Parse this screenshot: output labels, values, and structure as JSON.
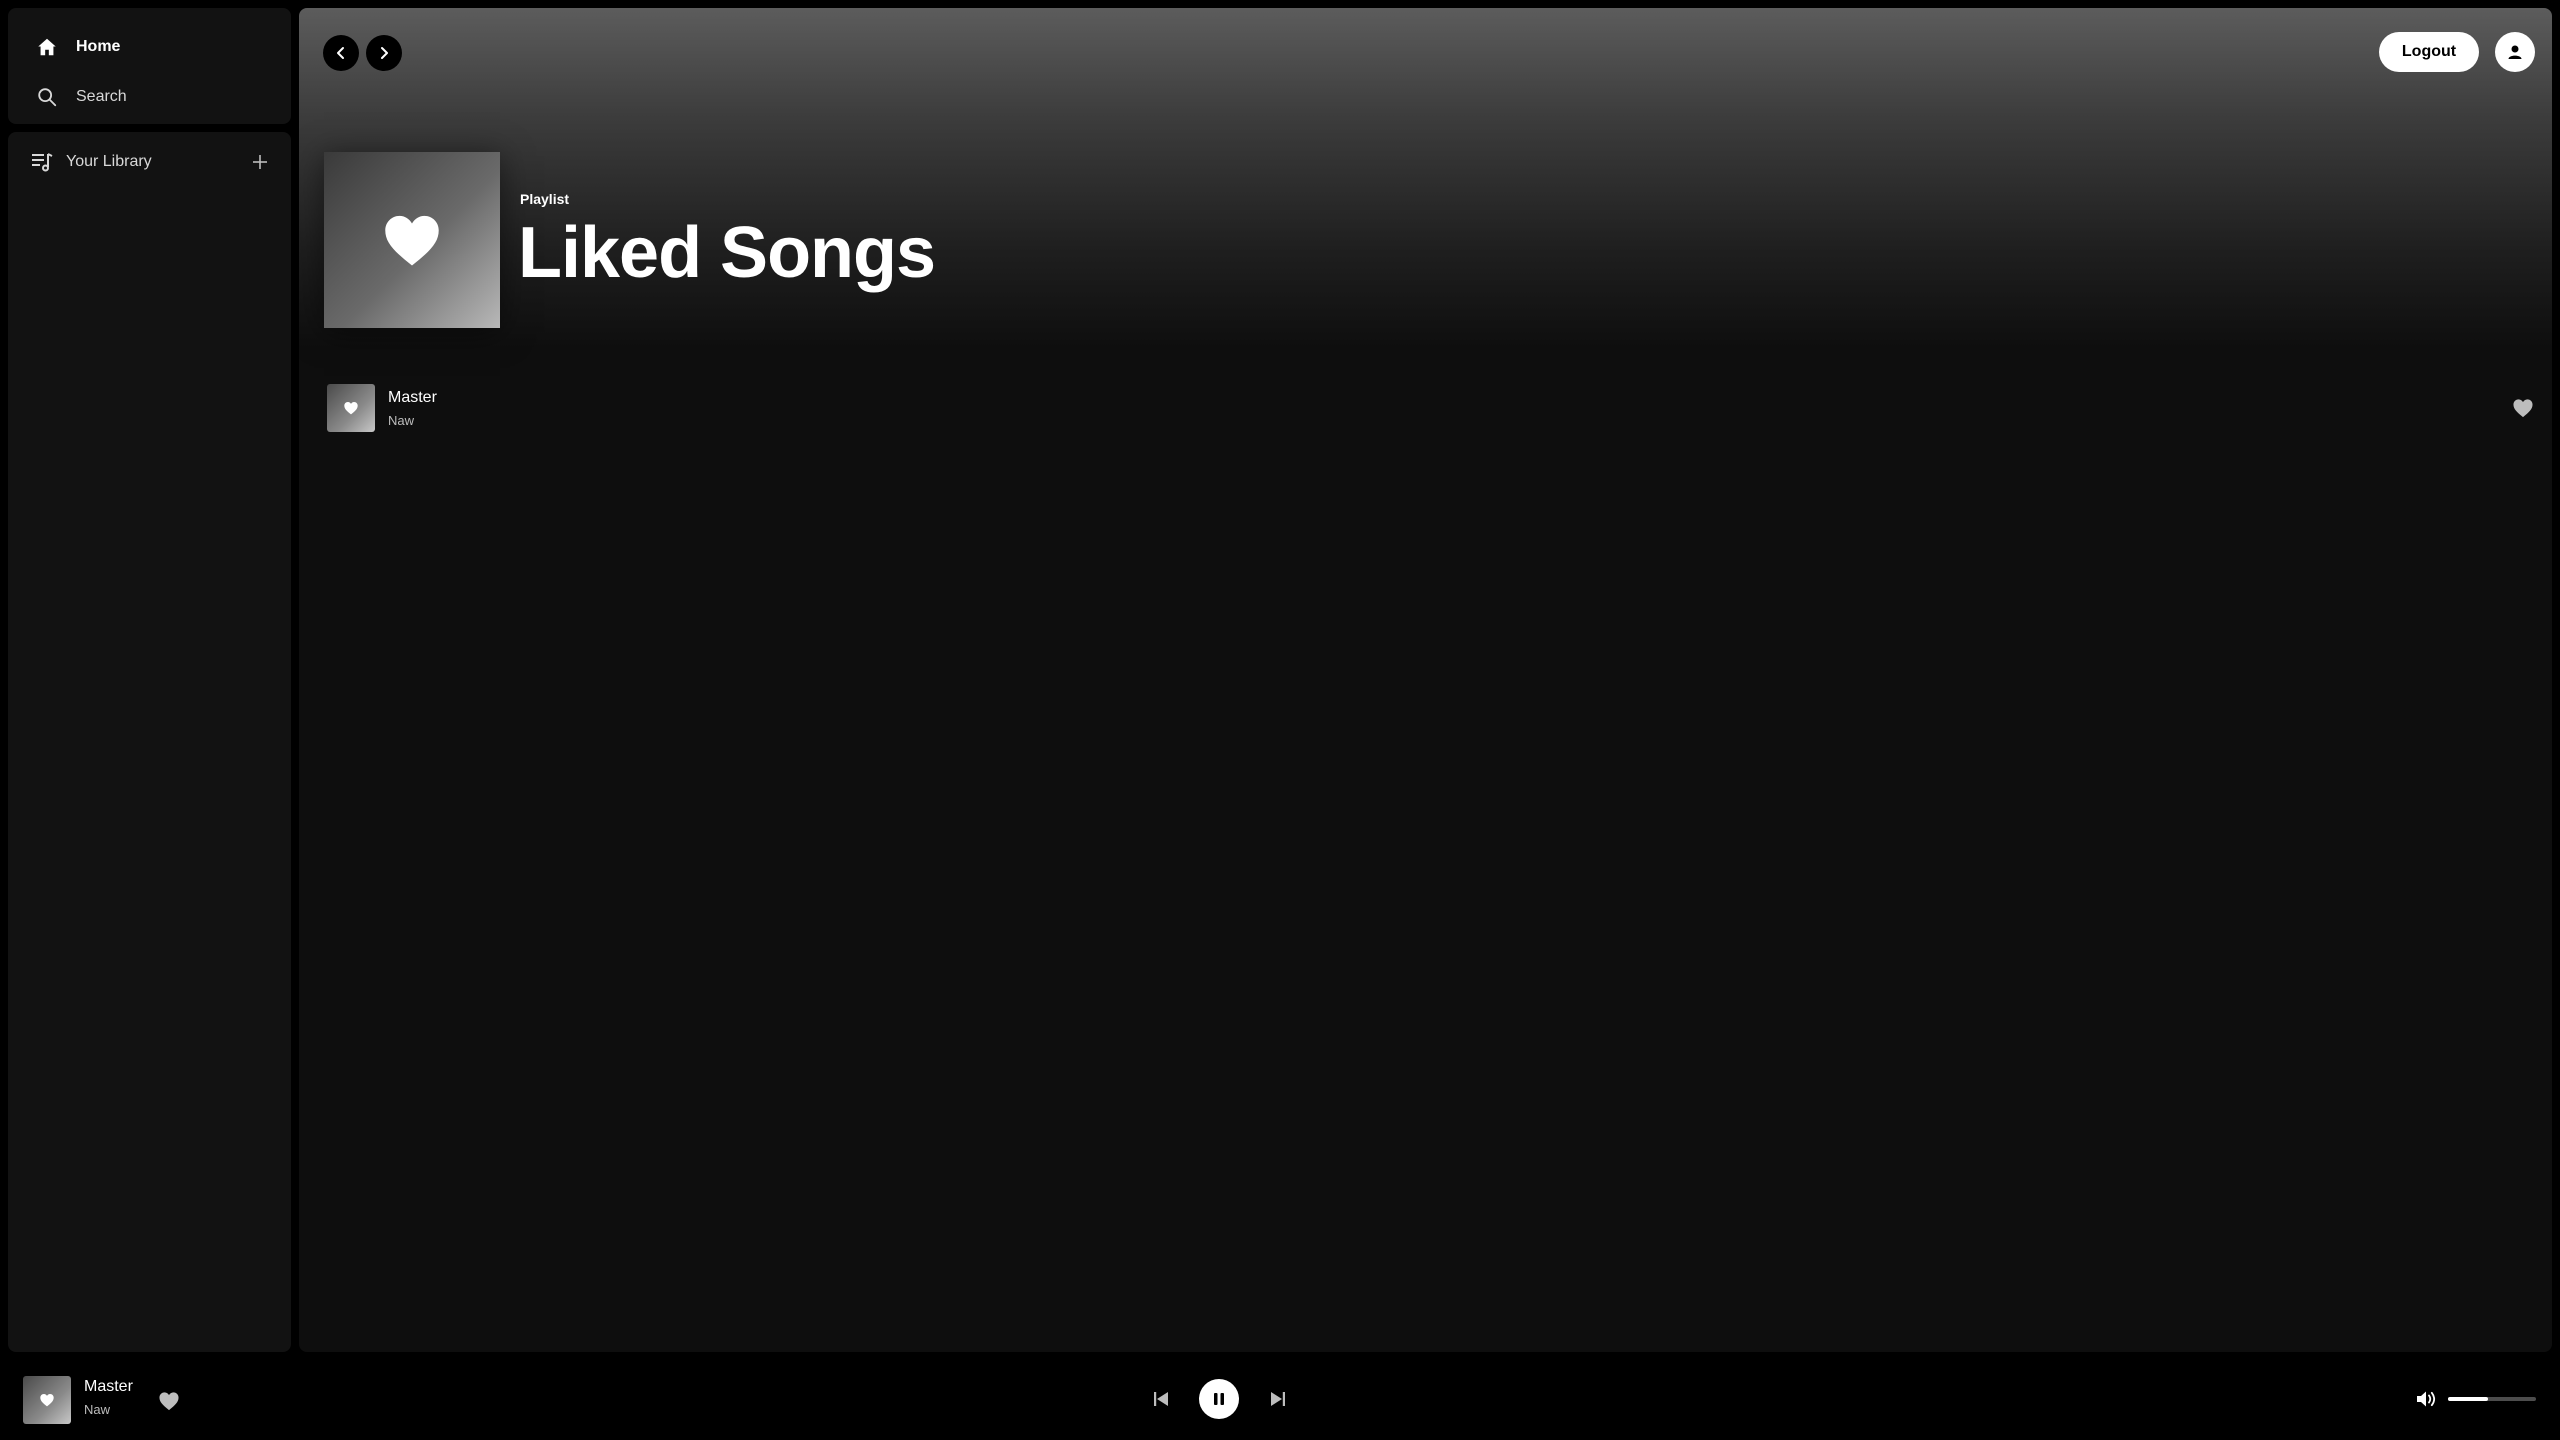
{
  "sidebar": {
    "home_label": "Home",
    "search_label": "Search",
    "library_label": "Your Library"
  },
  "header": {
    "logout_label": "Logout"
  },
  "playlist": {
    "type_label": "Playlist",
    "title": "Liked Songs",
    "songs": [
      {
        "title": "Master",
        "artist": "Naw"
      }
    ]
  },
  "player": {
    "title": "Master",
    "artist": "Naw",
    "state": "playing",
    "volume": 0.45
  },
  "icons": [
    "home-icon",
    "search-icon",
    "library-icon",
    "plus-icon",
    "chevron-left-icon",
    "chevron-right-icon",
    "user-icon",
    "heart-icon",
    "skip-back-icon",
    "pause-icon",
    "skip-forward-icon",
    "volume-icon"
  ],
  "colors": {
    "background": "#000000",
    "panel": "#121212",
    "accent": "#ffffff",
    "muted_text": "#bdbdbd"
  }
}
